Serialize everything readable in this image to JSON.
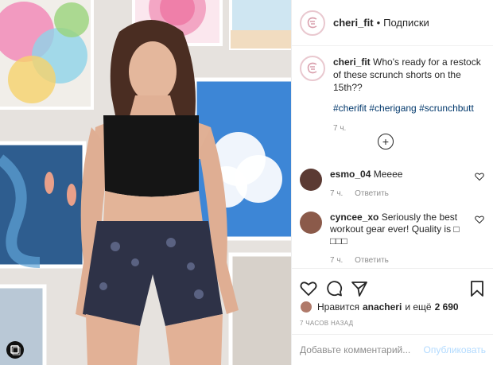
{
  "header": {
    "username": "cheri_fit",
    "separator": "•",
    "follow_label": "Подписки"
  },
  "caption": {
    "username": "cheri_fit",
    "text": "Who's ready for a restock of these scrunch shorts on the 15th??",
    "hashtags": "#cherifit #cherigang #scrunchbutt",
    "time": "7 ч."
  },
  "load_more": "+",
  "comments": [
    {
      "username": "esmo_04",
      "text": "Meeee",
      "time": "7 ч.",
      "reply_label": "Ответить"
    },
    {
      "username": "cyncee_xo",
      "text": "Seriously the best workout gear ever! Quality is □ □□□",
      "time": "7 ч.",
      "reply_label": "Ответить"
    }
  ],
  "likes": {
    "prefix": "Нравится",
    "user": "anacheri",
    "middle": "и ещё",
    "count": "2 690"
  },
  "time_ago": "7 ЧАСОВ НАЗАД",
  "comment_box": {
    "placeholder": "Добавьте комментарий...",
    "publish_label": "Опубликовать"
  },
  "colors": {
    "link": "#00376b",
    "muted": "#8e8e8e",
    "publish_disabled": "#b3dbff",
    "brand_ring": "#e9c8cf"
  },
  "icons": [
    "heart-icon",
    "comment-icon",
    "share-icon",
    "bookmark-icon",
    "multiple-images-icon",
    "plus-circle-icon"
  ]
}
